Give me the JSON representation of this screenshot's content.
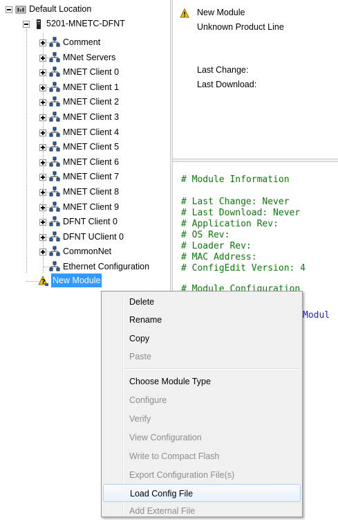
{
  "tree": {
    "root_label": "Default Location",
    "device_label": "5201-MNETC-DFNT",
    "nodes": [
      "Comment",
      "MNet Servers",
      "MNET Client 0",
      "MNET Client 1",
      "MNET Client 2",
      "MNET Client 3",
      "MNET Client 4",
      "MNET Client 5",
      "MNET Client 6",
      "MNET Client 7",
      "MNET Client 8",
      "MNET Client 9",
      "DFNT Client 0",
      "DFNT UClient 0",
      "CommonNet",
      "Ethernet Configuration"
    ],
    "selected_label": "New Module"
  },
  "info": {
    "title": "New Module",
    "product_line": "Unknown Product Line",
    "last_change_label": "Last Change:",
    "last_download_label": "Last Download:"
  },
  "code": {
    "lines": [
      "# Module Information",
      "",
      "# Last Change: Never",
      "# Last Download: Never",
      "# Application Rev:",
      "# OS Rev:",
      "# Loader Rev:",
      "# MAC Address:",
      "# ConfigEdit Version: 4",
      "",
      "# Module Configuration"
    ],
    "partial_text": "Modul"
  },
  "context_menu": {
    "items": [
      {
        "label": "Delete",
        "enabled": true
      },
      {
        "label": "Rename",
        "enabled": true
      },
      {
        "label": "Copy",
        "enabled": true
      },
      {
        "label": "Paste",
        "enabled": false
      },
      {
        "label": "Choose Module Type",
        "enabled": true
      },
      {
        "label": "Configure",
        "enabled": false
      },
      {
        "label": "Verify",
        "enabled": false
      },
      {
        "label": "View Configuration",
        "enabled": false
      },
      {
        "label": "Write to Compact Flash",
        "enabled": false
      },
      {
        "label": "Export Configuration File(s)",
        "enabled": false
      },
      {
        "label": "Load Config File",
        "enabled": true,
        "highlighted": true
      },
      {
        "label": "Add External File",
        "enabled": false
      }
    ]
  },
  "colors": {
    "selection": "#3399ff",
    "code_comment": "#0a7a0a",
    "code_keyword": "#1a1aff",
    "warning": "#f5c400"
  },
  "icons": {
    "root": "location-icon",
    "device": "module-chip-icon",
    "node": "network-icon",
    "selected": "warning-question-icon",
    "info": "warning-icon"
  }
}
